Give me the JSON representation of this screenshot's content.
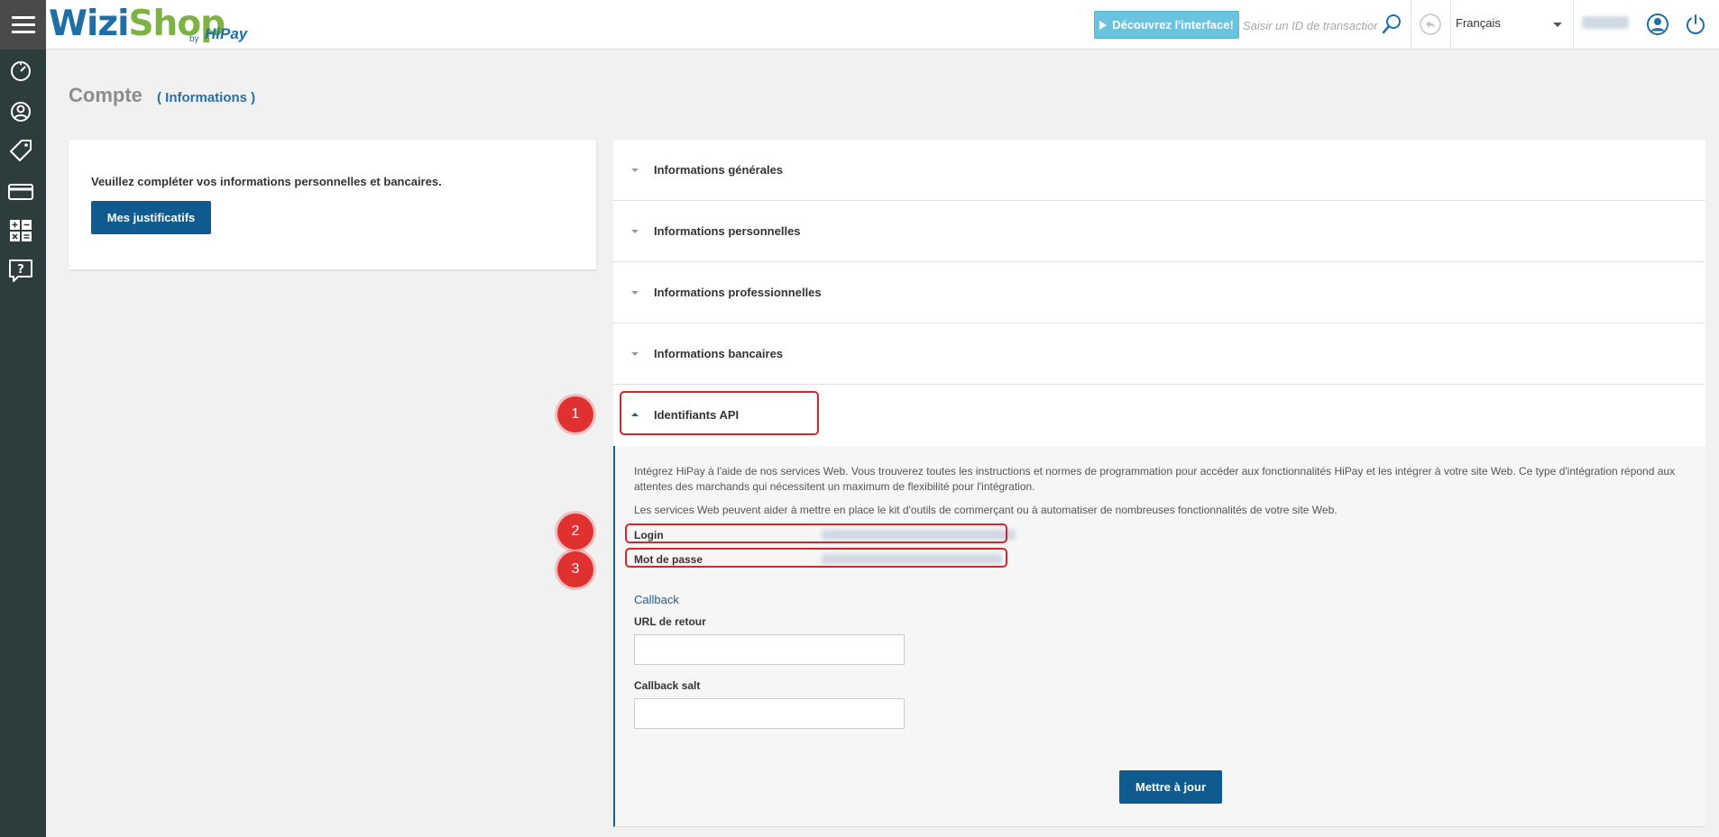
{
  "app": {
    "logo_wizi": "Wizi",
    "logo_shop": "Shop",
    "logo_by": "by",
    "logo_hipay": "HiPay"
  },
  "header": {
    "discover_label": "Découvrez l'interface!",
    "search_placeholder": "Saisir un ID de transaction",
    "language": "Français",
    "icons": [
      "menu-icon",
      "search-icon",
      "back-icon",
      "user-icon",
      "power-icon"
    ]
  },
  "sidebar": {
    "items": [
      "dashboard-icon",
      "account-icon",
      "tag-icon",
      "card-icon",
      "calculator-icon",
      "help-icon"
    ]
  },
  "page": {
    "title": "Compte",
    "subtitle": "( Informations )"
  },
  "left_card": {
    "message": "Veuillez compléter vos informations personnelles et bancaires.",
    "button_label": "Mes justificatifs"
  },
  "accordion": {
    "items": [
      {
        "label": "Informations générales"
      },
      {
        "label": "Informations personnelles"
      },
      {
        "label": "Informations professionnelles"
      },
      {
        "label": "Informations bancaires"
      },
      {
        "label": "Identifiants API"
      }
    ]
  },
  "api": {
    "paragraph1": "Intégrez HiPay à l'aide de nos services Web. Vous trouverez toutes les instructions et normes de programmation pour accéder aux fonctionnalités HiPay et les intégrer à votre site Web. Ce type d'intégration répond aux attentes des marchands qui nécessitent un maximum de flexibilité pour l'intégration.",
    "paragraph2": "Les services Web peuvent aider à mettre en place le kit d'outils de commerçant ou à automatiser de nombreuses fonctionnalités de votre site Web.",
    "login_label": "Login",
    "password_label": "Mot de passe",
    "callback_title": "Callback",
    "return_url_label": "URL de retour",
    "return_url_value": "",
    "salt_label": "Callback salt",
    "salt_value": "",
    "submit_label": "Mettre à jour"
  },
  "annotations": {
    "markers": [
      "1",
      "2",
      "3"
    ],
    "color": "#e0302f"
  },
  "colors": {
    "sidebar": "#2d3d3e",
    "primary_button": "#0f5a8e",
    "discover_button": "#6cc3e0",
    "link": "#2a6fa2"
  }
}
